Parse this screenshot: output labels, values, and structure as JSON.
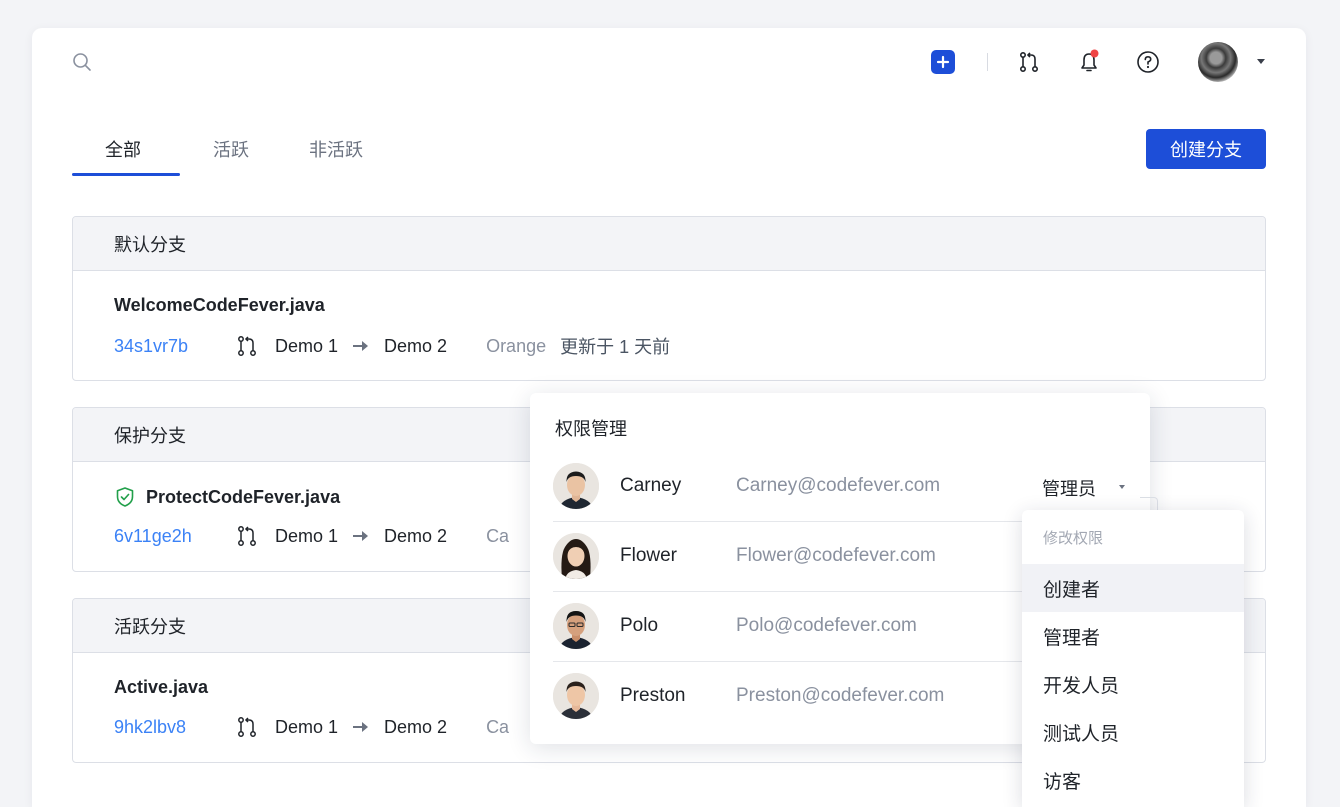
{
  "header": {
    "search_icon": "search-icon",
    "actions": [
      "plus-icon",
      "merge-request-icon",
      "bell-icon",
      "help-icon"
    ],
    "notification_dot_color": "#ef4444",
    "accent_color": "#1d4ed8"
  },
  "tabs": [
    {
      "label": "全部",
      "active": true
    },
    {
      "label": "活跃",
      "active": false
    },
    {
      "label": "非活跃",
      "active": false
    }
  ],
  "create_branch_label": "创建分支",
  "sections": [
    {
      "title": "默认分支",
      "branch": "WelcomeCodeFever.java",
      "protected": false,
      "commit": "34s1vr7b",
      "from": "Demo 1",
      "to": "Demo 2",
      "author": "Orange",
      "updated": "更新于 1 天前"
    },
    {
      "title": "保护分支",
      "branch": "ProtectCodeFever.java",
      "protected": true,
      "commit": "6v11ge2h",
      "from": "Demo 1",
      "to": "Demo 2",
      "author": "Ca"
    },
    {
      "title": "活跃分支",
      "branch": "Active.java",
      "protected": false,
      "commit": "9hk2lbv8",
      "from": "Demo 1",
      "to": "Demo 2",
      "author": "Ca"
    }
  ],
  "permission_panel": {
    "title": "权限管理",
    "members": [
      {
        "name": "Carney",
        "email": "Carney@codefever.com",
        "role": "管理员"
      },
      {
        "name": "Flower",
        "email": "Flower@codefever.com"
      },
      {
        "name": "Polo",
        "email": "Polo@codefever.com"
      },
      {
        "name": "Preston",
        "email": "Preston@codefever.com"
      }
    ]
  },
  "role_menu": {
    "header": "修改权限",
    "options": [
      "创建者",
      "管理者",
      "开发人员",
      "测试人员",
      "访客"
    ],
    "selected": "创建者"
  }
}
